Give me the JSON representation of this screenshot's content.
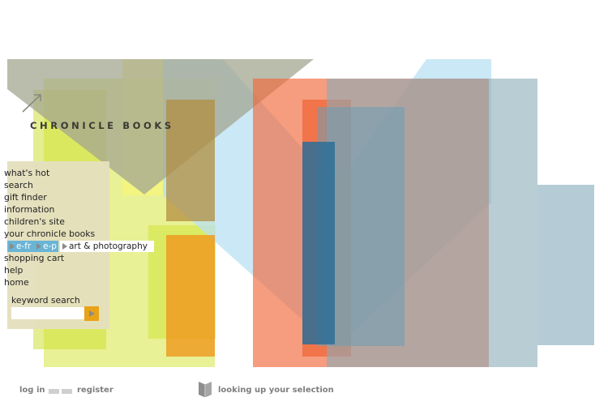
{
  "brand": {
    "name": "CHRONICLE BOOKS"
  },
  "nav": {
    "items": [
      {
        "label": "what's hot"
      },
      {
        "label": "search"
      },
      {
        "label": "gift finder"
      },
      {
        "label": "information"
      },
      {
        "label": "children's site"
      },
      {
        "label": "your chronicle books"
      }
    ],
    "breadcrumb": [
      {
        "label": "e-fr"
      },
      {
        "label": "e-p"
      }
    ],
    "breadcrumb_current": "art & photography",
    "items_after": [
      {
        "label": "shopping cart"
      },
      {
        "label": "help"
      },
      {
        "label": "home"
      }
    ]
  },
  "keyword_search": {
    "label": "keyword search",
    "value": "",
    "placeholder": ""
  },
  "footer": {
    "login": "log in",
    "register": "register",
    "status": "looking up your selection"
  },
  "icons": {
    "submit": "play-arrow-icon",
    "status": "book-icon",
    "logo_mark": "arrow-icon"
  },
  "colors": {
    "menu_bg": "#e4dfbd",
    "breadcrumb_bg": "#6ab4d6",
    "go_button": "#e8a317",
    "lime": "#d9ea52",
    "orange": "#f1673a",
    "blue": "#6aa6be",
    "olive_gray": "#a6a88e"
  }
}
